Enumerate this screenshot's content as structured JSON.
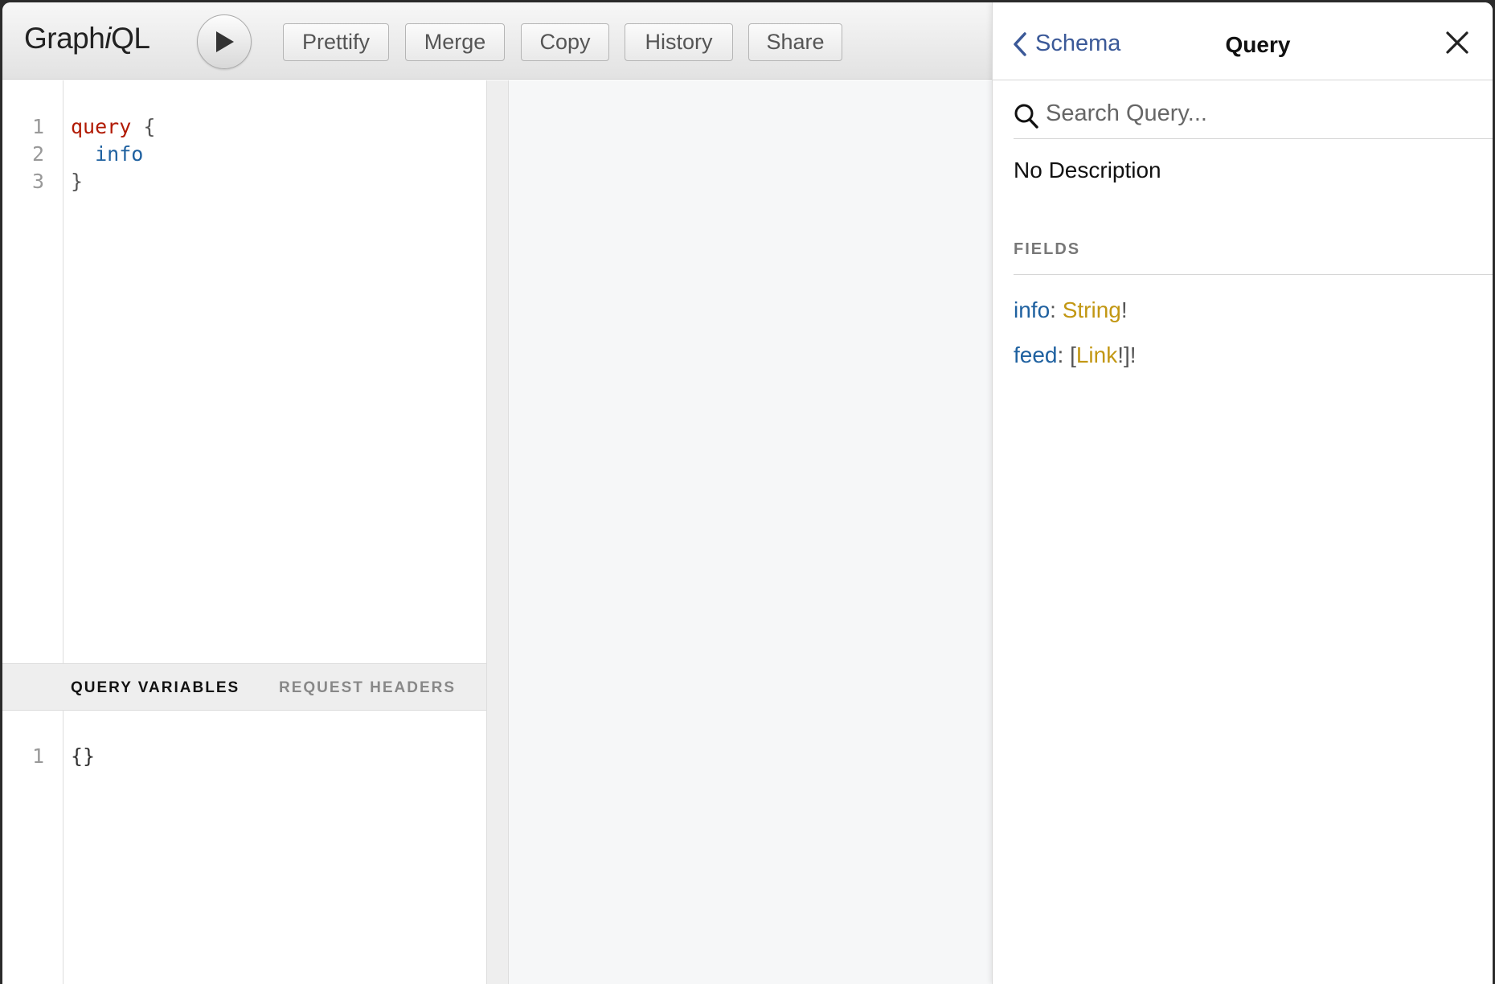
{
  "toolbar": {
    "logo_prefix": "Graph",
    "logo_italic": "i",
    "logo_suffix": "QL",
    "buttons": [
      {
        "label": "Prettify"
      },
      {
        "label": "Merge"
      },
      {
        "label": "Copy"
      },
      {
        "label": "History"
      },
      {
        "label": "Share"
      }
    ]
  },
  "query_editor": {
    "lines": [
      {
        "number": "1",
        "keyword": "query",
        "rest": " {"
      },
      {
        "number": "2",
        "field": "  info"
      },
      {
        "number": "3",
        "rest": "}"
      }
    ]
  },
  "variables": {
    "tabs": [
      "QUERY VARIABLES",
      "REQUEST HEADERS"
    ],
    "active_tab": "QUERY VARIABLES",
    "line_number": "1",
    "content": "{}"
  },
  "doc_explorer": {
    "back_label": "Schema",
    "title": "Query",
    "search_placeholder": "Search Query...",
    "description": "No Description",
    "fields_heading": "FIELDS",
    "fields": [
      {
        "name": "info",
        "sep": ": ",
        "prefix": "",
        "type": "String",
        "suffix": "!"
      },
      {
        "name": "feed",
        "sep": ": ",
        "prefix": "[",
        "type": "Link",
        "suffix": "!]!"
      }
    ]
  },
  "colors": {
    "keyword": "#b11a04",
    "field": "#1f61a0",
    "type": "#c29713",
    "link": "#3b5998"
  }
}
